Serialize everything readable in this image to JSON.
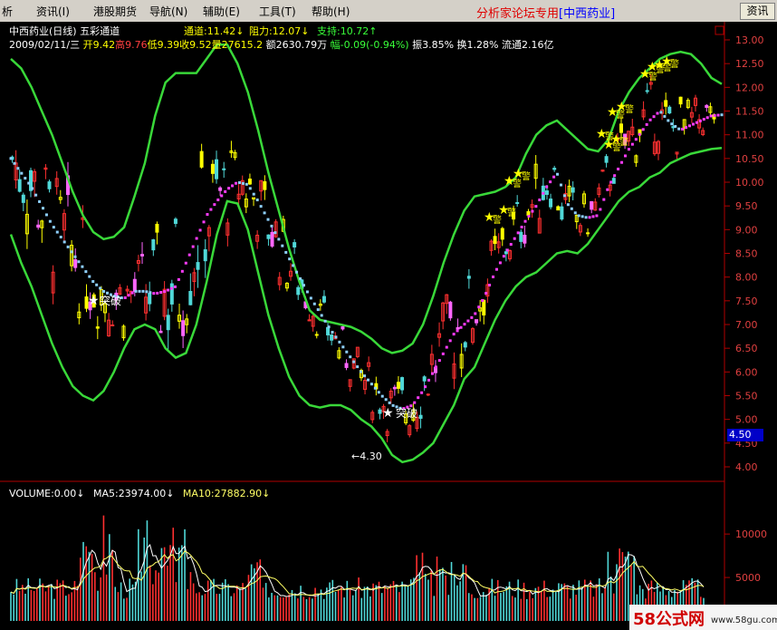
{
  "menu": {
    "items": [
      "析",
      "资讯(I)",
      "港股期货",
      "导航(N)",
      "辅助(E)",
      "工具(T)",
      "帮助(H)"
    ],
    "brand": "分析家论坛专用",
    "stock_name": "[中西药业]",
    "info_button": "资讯"
  },
  "header": {
    "title": "中西药业(日线) 五彩通道",
    "channel": "通道:11.42↓",
    "resistance": "阻力:12.07↓",
    "support": "支持:10.72↑",
    "ohlc": {
      "date": "2009/02/11/三",
      "open": "开9.42",
      "high": "高9.76",
      "low": "低9.39",
      "close": "收9.52",
      "volume": "量27615.2",
      "amount": "额2630.79万",
      "change": "幅-0.09(-0.94%)",
      "amplitude": "振3.85%",
      "turnover": "换1.28%",
      "float": "流通2.16亿"
    }
  },
  "volume_panel": {
    "volume": "VOLUME:0.00↓",
    "ma5": "MA5:23974.00↓",
    "ma10": "MA10:27882.90↓"
  },
  "annotations": {
    "breakout_label": "突破",
    "warn_label": "警",
    "low_marker": "←4.30",
    "breakout_star": "★",
    "warn_star": "★"
  },
  "price_badge": "4.50",
  "watermark": {
    "site": "58公式网",
    "url": "www.58gu.com"
  },
  "chart_data": [
    {
      "type": "candlestick",
      "title": "中西药业(日线) 五彩通道",
      "ylim": [
        4.0,
        13.0
      ],
      "y_ticks": [
        "13.00",
        "12.50",
        "12.00",
        "11.50",
        "11.00",
        "10.50",
        "10.00",
        "9.50",
        "9.00",
        "8.50",
        "8.00",
        "7.50",
        "7.00",
        "6.50",
        "6.00",
        "5.50",
        "5.00",
        "4.50",
        "4.00"
      ],
      "series": [
        {
          "name": "通道",
          "values": [
            10.5,
            10.2,
            9.9,
            9.5,
            9.1,
            8.8,
            8.5,
            8.2,
            7.9,
            7.7,
            7.6,
            7.55,
            7.7,
            7.7,
            7.65,
            7.7,
            7.8,
            8.3,
            8.8,
            9.3,
            9.6,
            9.85,
            10.0,
            9.95,
            9.6,
            9.2,
            8.8,
            8.4,
            8.0,
            7.6,
            7.25,
            6.9,
            6.6,
            6.3,
            6.0,
            5.75,
            5.5,
            5.3,
            5.22,
            5.3,
            5.6,
            6.0,
            6.4,
            6.8,
            7.0,
            7.2,
            7.6,
            8.1,
            8.5,
            8.85,
            9.2,
            9.5,
            9.9,
            10.2,
            9.55,
            9.3,
            9.25,
            9.3,
            9.9,
            10.3,
            10.7,
            11.0,
            11.3,
            11.5,
            11.25,
            11.1,
            11.2,
            11.3,
            11.4,
            11.42
          ]
        },
        {
          "name": "阻力",
          "values": [
            12.6,
            12.4,
            12.0,
            11.5,
            11.0,
            10.4,
            9.8,
            9.3,
            8.95,
            8.8,
            8.85,
            9.05,
            9.7,
            10.4,
            11.4,
            12.1,
            12.3,
            12.3,
            12.3,
            12.6,
            12.9,
            12.9,
            12.5,
            11.9,
            11.1,
            10.2,
            9.4,
            8.6,
            7.9,
            7.3,
            7.1,
            7.05,
            7.0,
            6.95,
            6.85,
            6.7,
            6.5,
            6.4,
            6.45,
            6.6,
            7.0,
            7.6,
            8.3,
            8.9,
            9.4,
            9.7,
            9.75,
            9.8,
            9.9,
            10.1,
            10.6,
            11.0,
            11.2,
            11.3,
            11.1,
            10.9,
            10.7,
            10.65,
            10.9,
            11.5,
            11.9,
            12.2,
            12.4,
            12.6,
            12.7,
            12.75,
            12.7,
            12.5,
            12.2,
            12.07
          ]
        },
        {
          "name": "支持",
          "values": [
            8.9,
            8.3,
            7.8,
            7.2,
            6.6,
            6.1,
            5.7,
            5.5,
            5.4,
            5.6,
            6.0,
            6.5,
            6.9,
            7.0,
            6.9,
            6.5,
            6.3,
            6.4,
            7.0,
            7.9,
            8.9,
            9.6,
            9.55,
            9.0,
            8.1,
            7.2,
            6.5,
            5.9,
            5.5,
            5.3,
            5.25,
            5.3,
            5.3,
            5.2,
            5.0,
            4.85,
            4.6,
            4.25,
            4.1,
            4.15,
            4.3,
            4.5,
            4.9,
            5.3,
            5.85,
            6.1,
            6.6,
            7.1,
            7.5,
            7.8,
            8.0,
            8.1,
            8.3,
            8.5,
            8.55,
            8.5,
            8.7,
            9.0,
            9.3,
            9.6,
            9.8,
            9.9,
            10.1,
            10.2,
            10.4,
            10.5,
            10.6,
            10.65,
            10.7,
            10.72
          ]
        }
      ]
    },
    {
      "type": "bar",
      "title": "VOLUME",
      "y_ticks": [
        "10000",
        "5000"
      ],
      "ylim": [
        0,
        14500
      ],
      "series": [
        {
          "name": "MA5",
          "last": 23974.0
        },
        {
          "name": "MA10",
          "last": 27882.9
        }
      ]
    }
  ],
  "colors": {
    "channel_green": "#39d839",
    "mid_cyan": "#8ed0ff",
    "mid_magenta": "#ff3cff",
    "up_red": "#ff3030",
    "down_cyan": "#50d8d8",
    "warn_yellow": "#ffff00",
    "ma5": "#ffffff",
    "ma10": "#ffff66",
    "axis_red": "#b00000"
  }
}
